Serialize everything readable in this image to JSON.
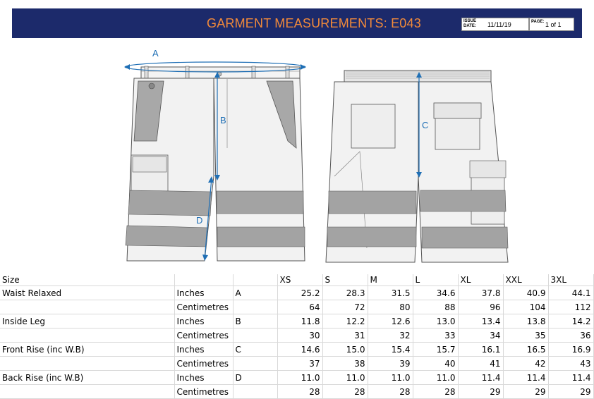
{
  "header": {
    "title": "GARMENT MEASUREMENTS: E043",
    "issue_label_1": "ISSUE",
    "issue_label_2": "DATE:",
    "issue_date": "11/11/19",
    "page_label": "PAGE:",
    "page_value": "1 of 1"
  },
  "drawing": {
    "labels": {
      "a": "A",
      "b": "B",
      "c": "C",
      "d": "D"
    }
  },
  "table": {
    "header_label": "Size",
    "sizes": [
      "XS",
      "S",
      "M",
      "L",
      "XL",
      "XXL",
      "3XL"
    ],
    "rows": [
      {
        "name": "Waist Relaxed",
        "unit": "Inches",
        "code": "A",
        "values": [
          "25.2",
          "28.3",
          "31.5",
          "34.6",
          "37.8",
          "40.9",
          "44.1"
        ]
      },
      {
        "name": "",
        "unit": "Centimetres",
        "code": "",
        "values": [
          "64",
          "72",
          "80",
          "88",
          "96",
          "104",
          "112"
        ]
      },
      {
        "name": "Inside Leg",
        "unit": "Inches",
        "code": "B",
        "values": [
          "11.8",
          "12.2",
          "12.6",
          "13.0",
          "13.4",
          "13.8",
          "14.2"
        ]
      },
      {
        "name": "",
        "unit": "Centimetres",
        "code": "",
        "values": [
          "30",
          "31",
          "32",
          "33",
          "34",
          "35",
          "36"
        ]
      },
      {
        "name": "Front Rise (inc W.B)",
        "unit": "Inches",
        "code": "C",
        "values": [
          "14.6",
          "15.0",
          "15.4",
          "15.7",
          "16.1",
          "16.5",
          "16.9"
        ]
      },
      {
        "name": "",
        "unit": "Centimetres",
        "code": "",
        "values": [
          "37",
          "38",
          "39",
          "40",
          "41",
          "42",
          "43"
        ]
      },
      {
        "name": "Back Rise (inc W.B)",
        "unit": "Inches",
        "code": "D",
        "values": [
          "11.0",
          "11.0",
          "11.0",
          "11.0",
          "11.4",
          "11.4",
          "11.4"
        ]
      },
      {
        "name": "",
        "unit": "Centimetres",
        "code": "",
        "values": [
          "28",
          "28",
          "28",
          "28",
          "29",
          "29",
          "29"
        ]
      }
    ]
  }
}
